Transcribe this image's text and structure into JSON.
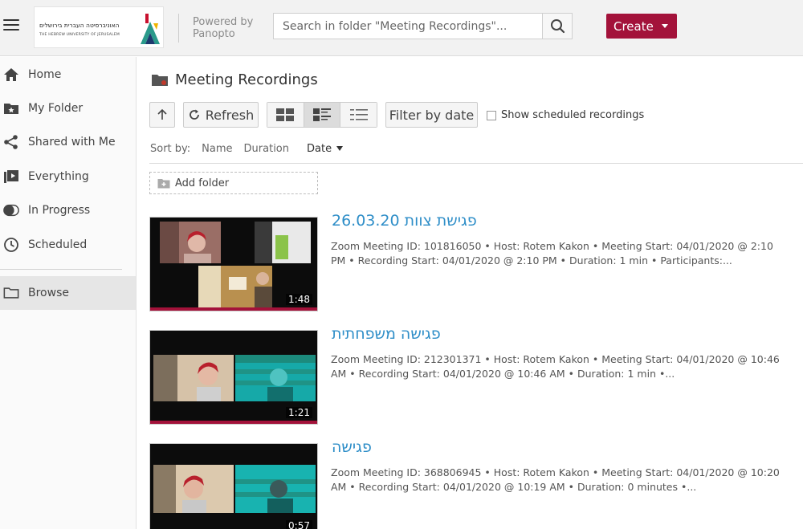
{
  "header": {
    "logo_text_he": "האוניברסיטה העברית בירושלים",
    "logo_text_en": "THE HEBREW UNIVERSITY OF JERUSALEM",
    "powered_line1": "Powered by",
    "powered_line2": "Panopto",
    "search_placeholder": "Search in folder \"Meeting Recordings\"...",
    "create_label": "Create",
    "accent_color": "#a3123a"
  },
  "sidebar": {
    "items": [
      {
        "label": "Home",
        "icon": "home-icon"
      },
      {
        "label": "My Folder",
        "icon": "folder-star-icon"
      },
      {
        "label": "Shared with Me",
        "icon": "share-icon"
      },
      {
        "label": "Everything",
        "icon": "video-library-icon"
      },
      {
        "label": "In Progress",
        "icon": "toggle-icon"
      },
      {
        "label": "Scheduled",
        "icon": "clock-icon"
      },
      {
        "label": "Browse",
        "icon": "folder-outline-icon"
      }
    ]
  },
  "main": {
    "title": "Meeting Recordings",
    "refresh_label": "Refresh",
    "filter_label": "Filter by date",
    "show_scheduled_label": "Show scheduled recordings",
    "sort_label": "Sort by:",
    "sort_name": "Name",
    "sort_duration": "Duration",
    "sort_date": "Date",
    "add_folder_label": "Add folder"
  },
  "sessions": [
    {
      "title": "פגישת צוות 26.03.20",
      "meta": "Zoom Meeting ID: 101816050   • Host: Rotem Kakon   • Meeting Start: 04/01/2020 @ 2:10 PM   • Recording Start: 04/01/2020 @ 2:10 PM   • Duration: 1 min   • Participants:...",
      "duration": "1:48"
    },
    {
      "title": "פגישה משפחתית",
      "meta": "Zoom Meeting ID: 212301371   • Host: Rotem Kakon   • Meeting Start: 04/01/2020 @ 10:46 AM   • Recording Start: 04/01/2020 @ 10:46 AM   • Duration: 1 min   •...",
      "duration": "1:21"
    },
    {
      "title": "פגישה",
      "meta": "Zoom Meeting ID: 368806945   • Host: Rotem Kakon   • Meeting Start: 04/01/2020 @ 10:20 AM   • Recording Start: 04/01/2020 @ 10:19 AM   • Duration: 0 minutes   •...",
      "duration": "0:57"
    }
  ]
}
